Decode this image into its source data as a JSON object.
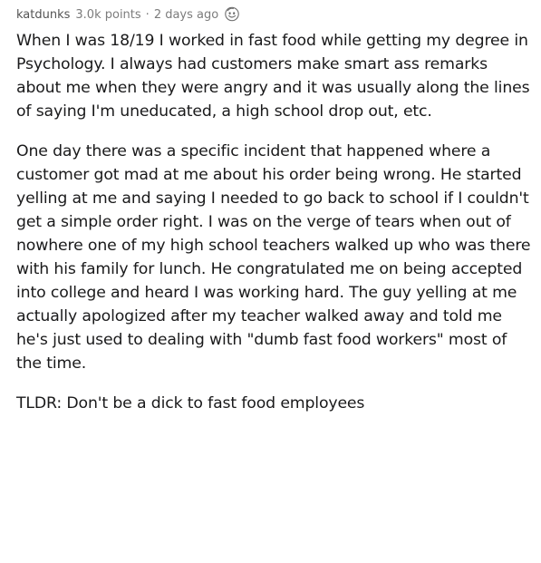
{
  "comment": {
    "author": "katdunks",
    "points": "3.0k points",
    "separator": "·",
    "age": "2 days ago",
    "award_icon": "smiley-award-icon",
    "paragraphs": [
      "When I was 18/19 I worked in fast food while getting my degree in Psychology. I always had customers make smart ass remarks about me when they were angry and it was usually along the lines of saying I'm uneducated, a high school drop out, etc.",
      "One day there was a specific incident that happened where a customer got mad at me about his order being wrong. He started yelling at me and saying I needed to go back to school if I couldn't get a simple order right. I was on the verge of tears when out of nowhere one of my high school teachers walked up who was there with his family for lunch. He congratulated me on being accepted into college and heard I was working hard. The guy yelling at me actually apologized after my teacher walked away and told me he's just used to dealing with \"dumb fast food workers\" most of the time.",
      "TLDR: Don't be a dick to fast food employees"
    ]
  },
  "colors": {
    "meta_text": "#7c7c7c",
    "body_text": "#1a1a1b",
    "background": "#ffffff"
  }
}
